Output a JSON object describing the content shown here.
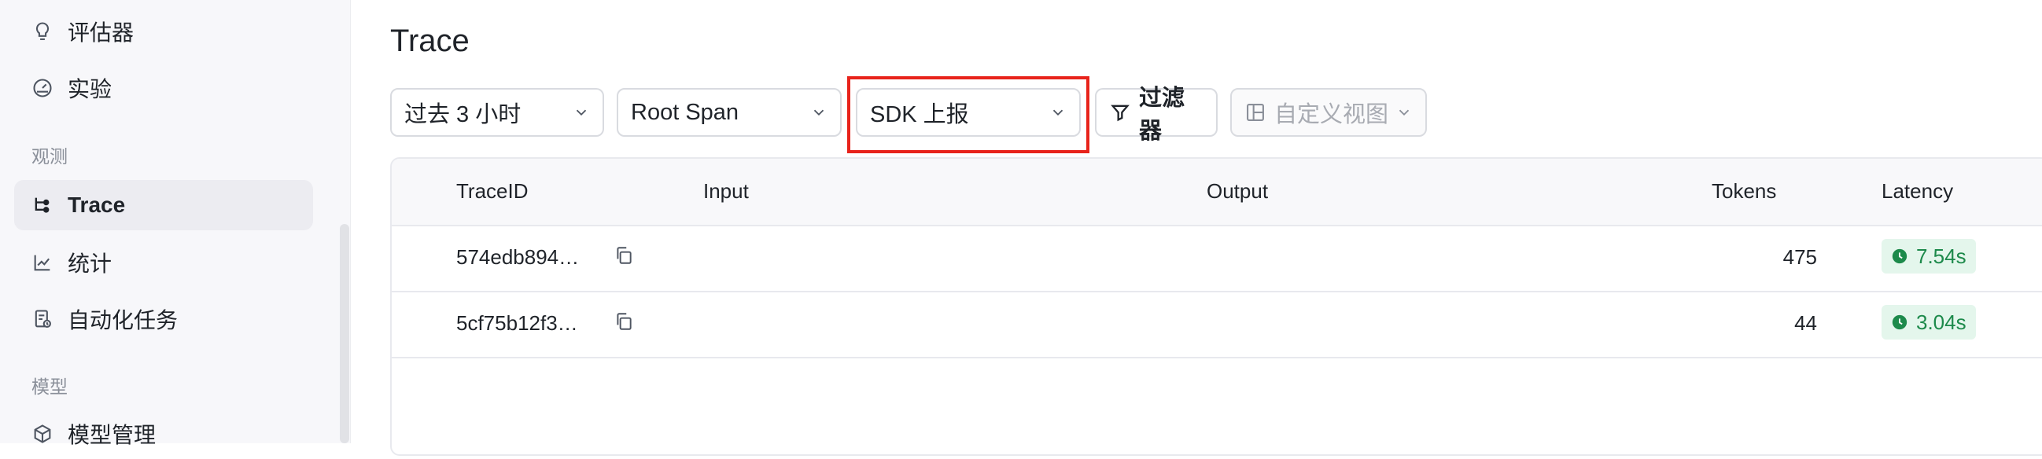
{
  "sidebar": {
    "items_top": [
      {
        "label": "评估器",
        "icon": "lightbulb-icon"
      },
      {
        "label": "实验",
        "icon": "gauge-icon"
      }
    ],
    "group_observe": "观测",
    "items_observe": [
      {
        "label": "Trace",
        "icon": "trace-icon",
        "active": true
      },
      {
        "label": "统计",
        "icon": "chart-icon"
      },
      {
        "label": "自动化任务",
        "icon": "task-icon"
      }
    ],
    "group_model": "模型",
    "items_model": [
      {
        "label": "模型管理",
        "icon": "cube-icon"
      }
    ]
  },
  "page": {
    "title": "Trace"
  },
  "toolbar": {
    "time_range": "过去 3 小时",
    "span_type": "Root Span",
    "source": "SDK 上报",
    "filter_label": "过滤器",
    "view_placeholder": "自定义视图"
  },
  "table": {
    "columns": [
      "TraceID",
      "Input",
      "Output",
      "Tokens",
      "Latency"
    ],
    "rows": [
      {
        "trace_id": "574edb894…",
        "input": "",
        "output": "",
        "tokens": "475",
        "latency": "7.54s"
      },
      {
        "trace_id": "5cf75b12f3…",
        "input": "",
        "output": "",
        "tokens": "44",
        "latency": "3.04s"
      }
    ]
  },
  "colors": {
    "highlight": "#e8231b",
    "latency_text": "#1d8a4b",
    "latency_bg": "#e4f6ec",
    "active_item_bg": "#ececf1"
  }
}
